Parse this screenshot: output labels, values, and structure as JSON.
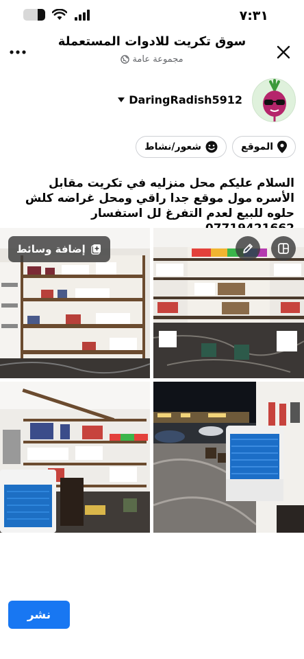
{
  "status": {
    "time": "٧:٣١",
    "battery_percent": 35
  },
  "header": {
    "title": "سوق تكريت للادوات المستعملة",
    "subtitle": "مجموعة عامة",
    "close_icon": "close-icon",
    "more_icon": "more-icon"
  },
  "author": {
    "name": "DaringRadish5912",
    "dropdown_icon": "caret-down-icon"
  },
  "chips": {
    "location": "الموقع",
    "feeling": "شعور/نشاط"
  },
  "post": {
    "text": "السلام عليكم محل منزليه في تكريت مقابل الأسره مول موقع جدا راقي ومحل غراضه كلش حلوه للبيع لعدم التفرغ لل استفسار 07719421662"
  },
  "media": {
    "add_media_label": "إضافة وسائط",
    "edit_icon": "pencil-icon",
    "layout_icon": "layout-icon"
  },
  "publish_label": "نشر",
  "colors": {
    "accent": "#1877f2",
    "text": "#050505",
    "muted": "#65676b"
  }
}
